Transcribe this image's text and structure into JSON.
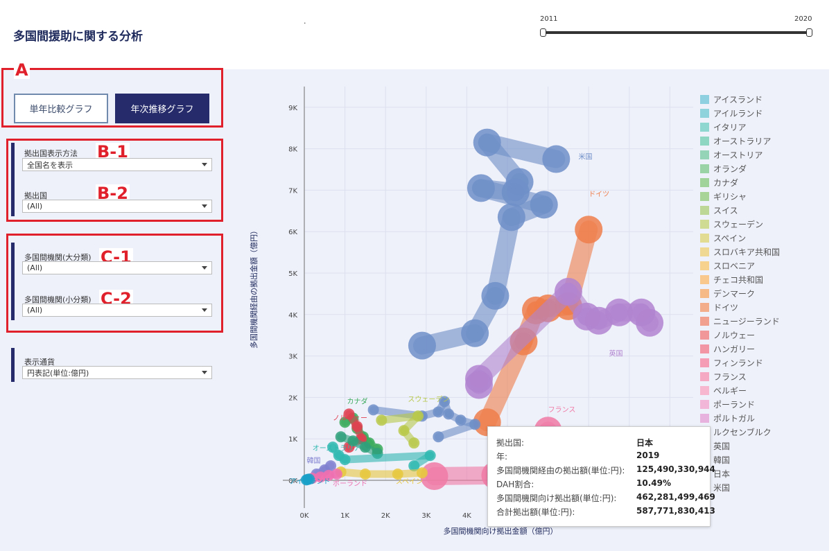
{
  "title": "多国間援助に関する分析",
  "dot": ".",
  "slider": {
    "start_label": "2011",
    "end_label": "2020"
  },
  "annotations": {
    "a": "A",
    "b1": "B-1",
    "b2": "B-2",
    "c1": "C-1",
    "c2": "C-2"
  },
  "buttons": {
    "single_year": "単年比較グラフ",
    "yearly_trend": "年次推移グラフ"
  },
  "filters": {
    "display_method": {
      "label": "拠出国表示方法",
      "value": "全国名を表示"
    },
    "donor": {
      "label": "拠出国",
      "value": "(All)"
    },
    "org_major": {
      "label": "多国間機関(大分類)",
      "value": "(All)"
    },
    "org_minor": {
      "label": "多国間機関(小分類)",
      "value": "(All)"
    },
    "currency": {
      "label": "表示通貨",
      "value": "円表記(単位:億円)"
    }
  },
  "legend": [
    {
      "name": "アイスランド",
      "color": "#8ecfe0"
    },
    {
      "name": "アイルランド",
      "color": "#8fd3dc"
    },
    {
      "name": "イタリア",
      "color": "#8ed7d1"
    },
    {
      "name": "オーストラリア",
      "color": "#8fd6c2"
    },
    {
      "name": "オーストリア",
      "color": "#95d4b6"
    },
    {
      "name": "オランダ",
      "color": "#99d3a6"
    },
    {
      "name": "カナダ",
      "color": "#9fd39a"
    },
    {
      "name": "ギリシャ",
      "color": "#a9d498"
    },
    {
      "name": "スイス",
      "color": "#bcd796"
    },
    {
      "name": "スウェーデン",
      "color": "#cfdb92"
    },
    {
      "name": "スペイン",
      "color": "#e2dc93"
    },
    {
      "name": "スロバキア共和国",
      "color": "#efd992"
    },
    {
      "name": "スロベニア",
      "color": "#f7d28e"
    },
    {
      "name": "チェコ共和国",
      "color": "#f8c88c"
    },
    {
      "name": "デンマーク",
      "color": "#f6ba86"
    },
    {
      "name": "ドイツ",
      "color": "#f3ad8a"
    },
    {
      "name": "ニュージーランド",
      "color": "#f19f8f"
    },
    {
      "name": "ノルウェー",
      "color": "#f1979a"
    },
    {
      "name": "ハンガリー",
      "color": "#f296a6"
    },
    {
      "name": "フィンランド",
      "color": "#f49db4"
    },
    {
      "name": "フランス",
      "color": "#f5a9c2"
    },
    {
      "name": "ベルギー",
      "color": "#f6b7cf"
    },
    {
      "name": "ポーランド",
      "color": "#f2b7d8"
    },
    {
      "name": "ポルトガル",
      "color": "#e8b2df"
    },
    {
      "name": "ルクセンブルク",
      "color": "#ddb0e2"
    },
    {
      "name": "英国",
      "color": "#cdb0e4"
    },
    {
      "name": "韓国",
      "color": "#b9b3e4"
    },
    {
      "name": "日本",
      "color": "#a6b5e2"
    },
    {
      "name": "米国",
      "color": "#97b4dd"
    }
  ],
  "tooltip": {
    "rows": [
      {
        "k": "拠出国:",
        "v": "日本"
      },
      {
        "k": "年:",
        "v": "2019"
      },
      {
        "k": "多国間機関経由の拠出額(単位:円):",
        "v": "125,490,330,944"
      },
      {
        "k": "DAH割合:",
        "v": "10.49%"
      },
      {
        "k": "多国間機関向け拠出額(単位:円):",
        "v": "462,281,499,469"
      },
      {
        "k": "合計拠出額(単位:円):",
        "v": "587,771,830,413"
      }
    ]
  },
  "chart_data": {
    "type": "scatter",
    "xlabel": "多国間機関向け拠出金額（億円）",
    "ylabel": "多国間機関経由の拠出金額（億円）",
    "x_ticks": [
      "0K",
      "1K",
      "2K",
      "3K",
      "4K"
    ],
    "y_ticks": [
      "0K",
      "1K",
      "2K",
      "3K",
      "4K",
      "5K",
      "6K",
      "7K",
      "8K",
      "9K"
    ],
    "xlim": [
      0,
      9000
    ],
    "ylim": [
      0,
      9500
    ],
    "series": [
      {
        "name": "米国",
        "color": "#6f8fc8",
        "label": "米国",
        "label_at": [
          6750,
          7750
        ],
        "points": [
          [
            2900,
            3250
          ],
          [
            4200,
            3550
          ],
          [
            4700,
            4450
          ],
          [
            5100,
            6350
          ],
          [
            5900,
            6650
          ],
          [
            4350,
            7050
          ],
          [
            5200,
            6950
          ],
          [
            5300,
            7200
          ],
          [
            4500,
            8150
          ],
          [
            6200,
            7750
          ]
        ]
      },
      {
        "name": "ドイツ",
        "color": "#ee7e4a",
        "label": "ドイツ",
        "label_at": [
          7000,
          6850
        ],
        "points": [
          [
            4500,
            1400
          ],
          [
            5400,
            3350
          ],
          [
            5700,
            4100
          ],
          [
            6000,
            4150
          ],
          [
            6500,
            4200
          ],
          [
            7000,
            6050
          ]
        ]
      },
      {
        "name": "英国",
        "color": "#b184d0",
        "label": "英国",
        "label_at": [
          7500,
          3000
        ],
        "points": [
          [
            4300,
            2300
          ],
          [
            4300,
            2450
          ],
          [
            6500,
            4550
          ],
          [
            6950,
            3950
          ],
          [
            7250,
            3850
          ],
          [
            7750,
            4050
          ],
          [
            8300,
            4050
          ],
          [
            8500,
            3800
          ]
        ]
      },
      {
        "name": "フランス",
        "color": "#f07aa4",
        "label": "フランス",
        "label_at": [
          6000,
          1650
        ],
        "points": [
          [
            3200,
            100
          ],
          [
            4700,
            120
          ],
          [
            5600,
            140
          ],
          [
            6000,
            1200
          ]
        ]
      },
      {
        "name": "日本",
        "color": "#6f8fc8",
        "label": "",
        "label_at": [
          0,
          0
        ],
        "points": [
          [
            1700,
            1700
          ],
          [
            2900,
            1550
          ],
          [
            3300,
            1650
          ],
          [
            3450,
            1900
          ],
          [
            3550,
            1600
          ],
          [
            3850,
            1450
          ],
          [
            4200,
            1350
          ],
          [
            3300,
            1050
          ]
        ]
      },
      {
        "name": "スウェーデン",
        "color": "#b8c94a",
        "label": "スウェーデン",
        "label_at": [
          2550,
          1900
        ],
        "points": [
          [
            1900,
            1450
          ],
          [
            2800,
            1550
          ],
          [
            2450,
            1200
          ],
          [
            2700,
            900
          ]
        ]
      },
      {
        "name": "カナダ",
        "color": "#3aaa5a",
        "label": "カナダ",
        "label_at": [
          1050,
          1850
        ],
        "points": [
          [
            1000,
            1400
          ],
          [
            1200,
            1500
          ],
          [
            1300,
            1250
          ],
          [
            1450,
            1050
          ],
          [
            1600,
            900
          ],
          [
            1800,
            750
          ]
        ]
      },
      {
        "name": "ノルウェー",
        "color": "#e04050",
        "label": "ノルウェー",
        "label_at": [
          700,
          1450
        ],
        "points": [
          [
            1100,
            1600
          ],
          [
            1300,
            1300
          ],
          [
            1400,
            1000
          ],
          [
            1100,
            800
          ]
        ]
      },
      {
        "name": "オランダ",
        "color": "#2fa07a",
        "label": "",
        "label_at": [
          0,
          0
        ],
        "points": [
          [
            900,
            1050
          ],
          [
            1200,
            950
          ],
          [
            1500,
            800
          ],
          [
            1800,
            650
          ]
        ]
      },
      {
        "name": "オーストラリア",
        "color": "#30b8b0",
        "label": "オーストラリア",
        "label_at": [
          200,
          720
        ],
        "points": [
          [
            700,
            800
          ],
          [
            850,
            600
          ],
          [
            1000,
            500
          ],
          [
            3100,
            600
          ],
          [
            2700,
            350
          ]
        ]
      },
      {
        "name": "スペイン",
        "color": "#e8c840",
        "label": "スペイン",
        "label_at": [
          2250,
          -80
        ],
        "points": [
          [
            900,
            200
          ],
          [
            1500,
            150
          ],
          [
            2300,
            150
          ],
          [
            2900,
            180
          ]
        ]
      },
      {
        "name": "韓国",
        "color": "#8080d0",
        "label": "韓国",
        "label_at": [
          60,
          420
        ],
        "points": [
          [
            300,
            150
          ],
          [
            500,
            250
          ],
          [
            650,
            350
          ]
        ]
      },
      {
        "name": "ポーランド",
        "color": "#ee70b0",
        "label": "ポーランド",
        "label_at": [
          700,
          -130
        ],
        "points": [
          [
            200,
            50
          ],
          [
            400,
            80
          ],
          [
            600,
            120
          ],
          [
            800,
            150
          ]
        ]
      },
      {
        "name": "アイスランド",
        "color": "#1aa0c8",
        "label": "アイスランド",
        "label_at": [
          -370,
          -80
        ],
        "points": [
          [
            50,
            10
          ],
          [
            80,
            20
          ],
          [
            120,
            30
          ]
        ]
      }
    ]
  }
}
